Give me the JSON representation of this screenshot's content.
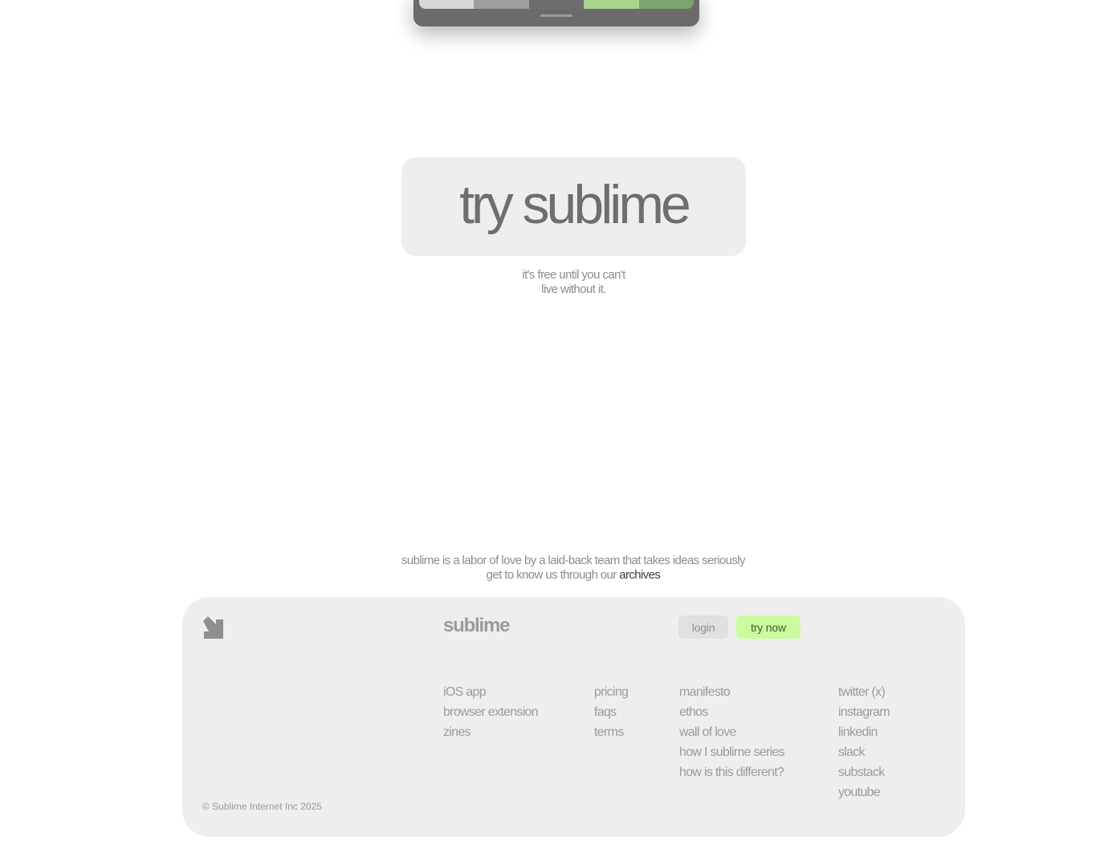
{
  "device_preview": {
    "swatch_colors": [
      "#d8d8d8",
      "#9e9e9e",
      "#6e6e6e",
      "#a9d48e",
      "#7aa56c"
    ]
  },
  "cta": {
    "label": "try sublime",
    "subtitle_line1": "it's free until you can't",
    "subtitle_line2": "live without it."
  },
  "about": {
    "line1": "sublime is a labor of love by a laid-back team that takes ideas seriously",
    "line2_prefix": "get to know us through our ",
    "line2_link": "archives"
  },
  "footer": {
    "logo_icon": "arrow-down-right-icon",
    "brand": "sublime",
    "login_label": "login",
    "try_now_label": "try now",
    "columns": [
      [
        "iOS app",
        "browser extension",
        "zines"
      ],
      [
        "pricing",
        "faqs",
        "terms"
      ],
      [
        "manifesto",
        "ethos",
        "wall of love",
        "how I sublime series",
        "how is this different?"
      ],
      [
        "twitter (x)",
        "instagram",
        "linkedin",
        "slack",
        "substack",
        "youtube"
      ]
    ],
    "copyright": "© Sublime Internet Inc 2025"
  },
  "colors": {
    "page_bg": "#ffffff",
    "panel_bg": "#eeeeee",
    "accent_green": "#ccfb9f",
    "text_muted": "#9b9b9b"
  }
}
